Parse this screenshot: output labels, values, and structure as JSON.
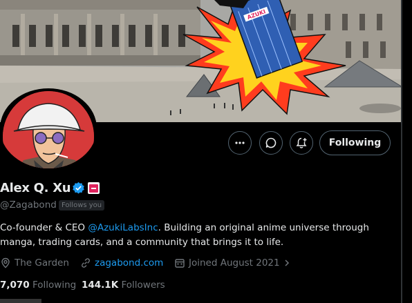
{
  "profile": {
    "name": "Alex Q. Xu",
    "handle": "@Zagabond",
    "follows_you": "Follows you",
    "bio_prefix": "Co-founder & CEO ",
    "bio_mention": "@AzukiLabsInc",
    "bio_suffix": ". Building an original anime universe through manga, trading cards, and a community that brings it to life.",
    "location": "The Garden",
    "website": "zagabond.com",
    "joined": "Joined August 2021",
    "following_count": "7,070",
    "following_label": "Following",
    "followers_count": "144.1K",
    "followers_label": "Followers"
  },
  "actions": {
    "follow_button": "Following"
  },
  "banner": {
    "sign_text": "AZUKI"
  },
  "colors": {
    "accent": "#1d9bf0",
    "background": "#000000",
    "muted": "#71767b",
    "avatar_bg": "#d63a3a"
  },
  "icons": [
    "more-icon",
    "message-icon",
    "notification-add-icon",
    "verified-icon",
    "affiliation-badge-icon",
    "location-icon",
    "link-icon",
    "calendar-icon",
    "chevron-right-icon"
  ]
}
